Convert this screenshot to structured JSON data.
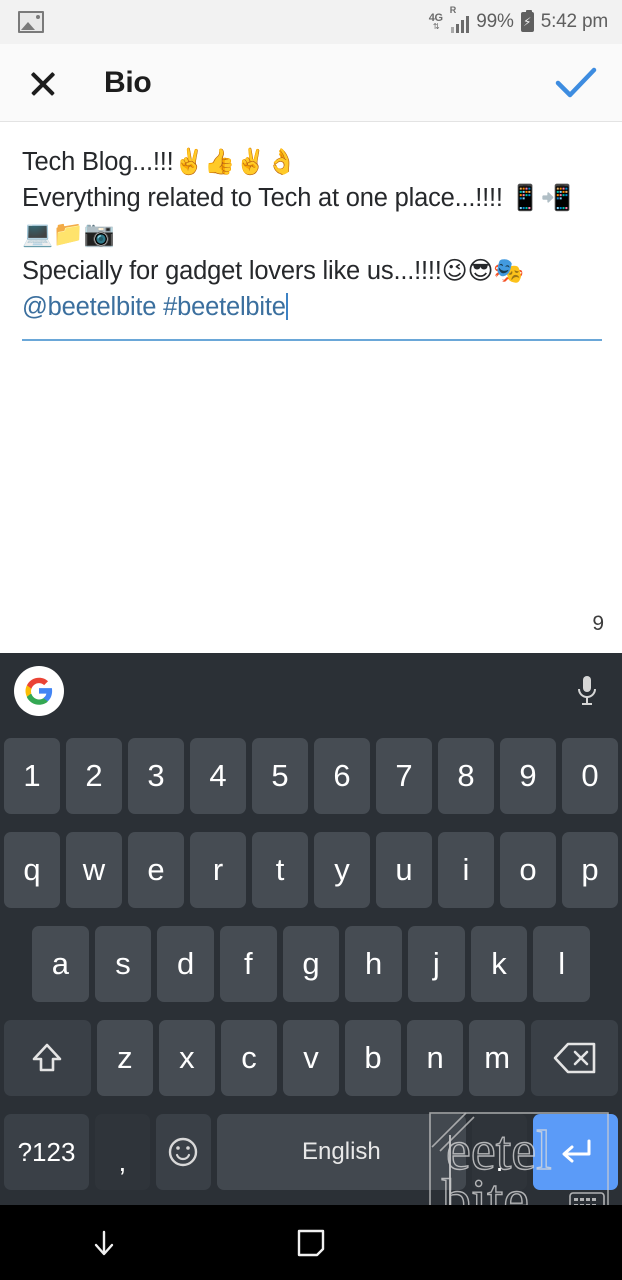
{
  "status_bar": {
    "notification_icon": "gallery-image-icon",
    "network_type": "4G",
    "network_arrows": "⇅",
    "roaming_indicator": "R",
    "battery_percent": "99%",
    "battery_icon": "battery-charging-icon",
    "time": "5:42 pm"
  },
  "app_bar": {
    "close_icon": "close-x-icon",
    "title": "Bio",
    "confirm_icon": "checkmark-icon",
    "accent_color": "#3d8ce0"
  },
  "editor": {
    "line1": "Tech Blog...!!!",
    "line1_emojis": "✌️👍✌️👌",
    "line2": "Everything related to Tech at one place...!!!! ",
    "line2_emojis": "📱📲💻📁📷",
    "line3": "Specially for gadget lovers like us...!!!!",
    "line3_emojis": "😉😎🎭",
    "mention": "@beetelbite",
    "hashtag": "#beetelbite",
    "tag_color": "#3b6f9e",
    "char_counter": "9",
    "underline_color": "#6aa7d8"
  },
  "keyboard": {
    "logo": "google-g-icon",
    "mic_icon": "microphone-icon",
    "row_numbers": [
      "1",
      "2",
      "3",
      "4",
      "5",
      "6",
      "7",
      "8",
      "9",
      "0"
    ],
    "row_top": [
      "q",
      "w",
      "e",
      "r",
      "t",
      "y",
      "u",
      "i",
      "o",
      "p"
    ],
    "row_home": [
      "a",
      "s",
      "d",
      "f",
      "g",
      "h",
      "j",
      "k",
      "l"
    ],
    "row_bottom": [
      "z",
      "x",
      "c",
      "v",
      "b",
      "n",
      "m"
    ],
    "shift_icon": "shift-arrow-icon",
    "backspace_icon": "backspace-icon",
    "symbols_key": "?123",
    "comma_key": ",",
    "emoji_key_icon": "emoji-smiley-icon",
    "space_key": "English",
    "period_key": ".",
    "enter_icon": "enter-return-icon",
    "enter_color": "#5b9bf8",
    "key_color": "#464c53",
    "background_color": "#2b3036"
  },
  "nav_bar": {
    "back_icon": "hide-keyboard-down-arrow-icon",
    "home_icon": "recents-square-icon",
    "keyboard_icon": "keyboard-switch-icon"
  },
  "watermark": {
    "text": "beetelbite"
  }
}
